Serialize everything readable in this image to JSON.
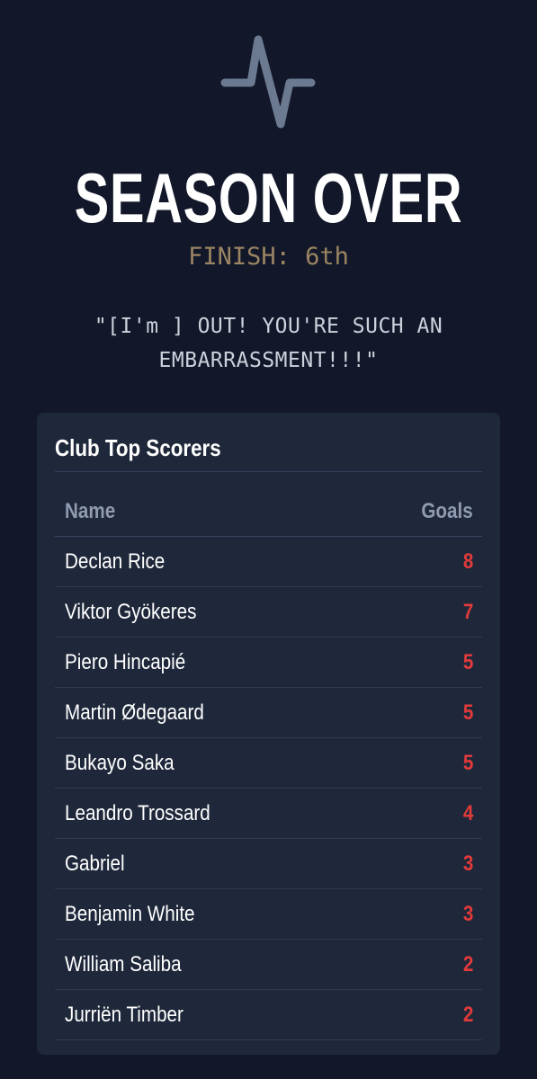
{
  "icon": "pulse-icon",
  "colors": {
    "background": "#121829",
    "card": "#1f283a",
    "finish_text": "#9a8463",
    "goals_accent": "#e03a3a",
    "icon": "#6b7a90"
  },
  "header": {
    "title": "SEASON OVER",
    "finish": "FINISH: 6th",
    "quote": "\"[I'm ] OUT! YOU'RE SUCH AN EMBARRASSMENT!!!\""
  },
  "scorers": {
    "title": "Club Top Scorers",
    "columns": {
      "name": "Name",
      "goals": "Goals"
    },
    "rows": [
      {
        "name": "Declan Rice",
        "goals": "8"
      },
      {
        "name": "Viktor Gyökeres",
        "goals": "7"
      },
      {
        "name": "Piero Hincapié",
        "goals": "5"
      },
      {
        "name": "Martin Ødegaard",
        "goals": "5"
      },
      {
        "name": "Bukayo Saka",
        "goals": "5"
      },
      {
        "name": "Leandro Trossard",
        "goals": "4"
      },
      {
        "name": "Gabriel",
        "goals": "3"
      },
      {
        "name": "Benjamin White",
        "goals": "3"
      },
      {
        "name": "William Saliba",
        "goals": "2"
      },
      {
        "name": "Jurriën Timber",
        "goals": "2"
      }
    ]
  }
}
